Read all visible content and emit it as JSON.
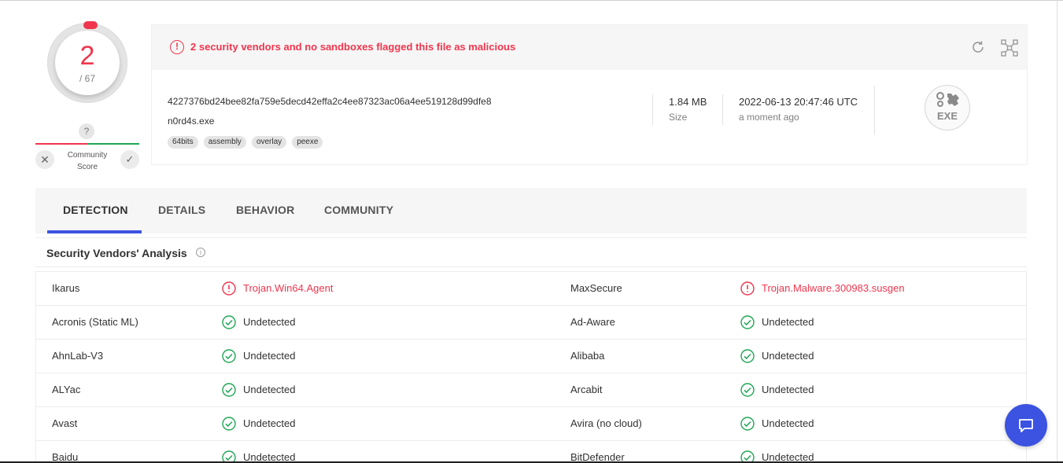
{
  "score": {
    "detections": "2",
    "total": "/ 67"
  },
  "community": {
    "label_line1": "Community",
    "label_line2": "Score",
    "help": "?",
    "downvote": "✕",
    "upvote": "✓"
  },
  "banner": {
    "text": "2 security vendors and no sandboxes flagged this file as malicious",
    "icon": "alert-circle-icon"
  },
  "file": {
    "hash": "4227376bd24bee82fa759e5decd42effa2c4ee87323ac06a4ee519128d99dfe8",
    "name": "n0rd4s.exe",
    "tags": [
      "64bits",
      "assembly",
      "overlay",
      "peexe"
    ],
    "size": "1.84 MB",
    "size_label": "Size",
    "date": "2022-06-13 20:47:46 UTC",
    "date_label": "a moment ago",
    "type_badge": "EXE"
  },
  "tabs": [
    {
      "label": "DETECTION",
      "active": true
    },
    {
      "label": "DETAILS",
      "active": false
    },
    {
      "label": "BEHAVIOR",
      "active": false
    },
    {
      "label": "COMMUNITY",
      "active": false
    }
  ],
  "section": {
    "title": "Security Vendors' Analysis",
    "info": "i"
  },
  "vendors": [
    {
      "left": {
        "name": "Ikarus",
        "result": "Trojan.Win64.Agent",
        "malicious": true
      },
      "right": {
        "name": "MaxSecure",
        "result": "Trojan.Malware.300983.susgen",
        "malicious": true
      }
    },
    {
      "left": {
        "name": "Acronis (Static ML)",
        "result": "Undetected",
        "malicious": false
      },
      "right": {
        "name": "Ad-Aware",
        "result": "Undetected",
        "malicious": false
      }
    },
    {
      "left": {
        "name": "AhnLab-V3",
        "result": "Undetected",
        "malicious": false
      },
      "right": {
        "name": "Alibaba",
        "result": "Undetected",
        "malicious": false
      }
    },
    {
      "left": {
        "name": "ALYac",
        "result": "Undetected",
        "malicious": false
      },
      "right": {
        "name": "Arcabit",
        "result": "Undetected",
        "malicious": false
      }
    },
    {
      "left": {
        "name": "Avast",
        "result": "Undetected",
        "malicious": false
      },
      "right": {
        "name": "Avira (no cloud)",
        "result": "Undetected",
        "malicious": false
      }
    },
    {
      "left": {
        "name": "Baidu",
        "result": "Undetected",
        "malicious": false
      },
      "right": {
        "name": "BitDefender",
        "result": "Undetected",
        "malicious": false
      }
    }
  ],
  "colors": {
    "malicious": "#f0364e",
    "clean": "#20a656",
    "accent": "#3b53e0"
  }
}
